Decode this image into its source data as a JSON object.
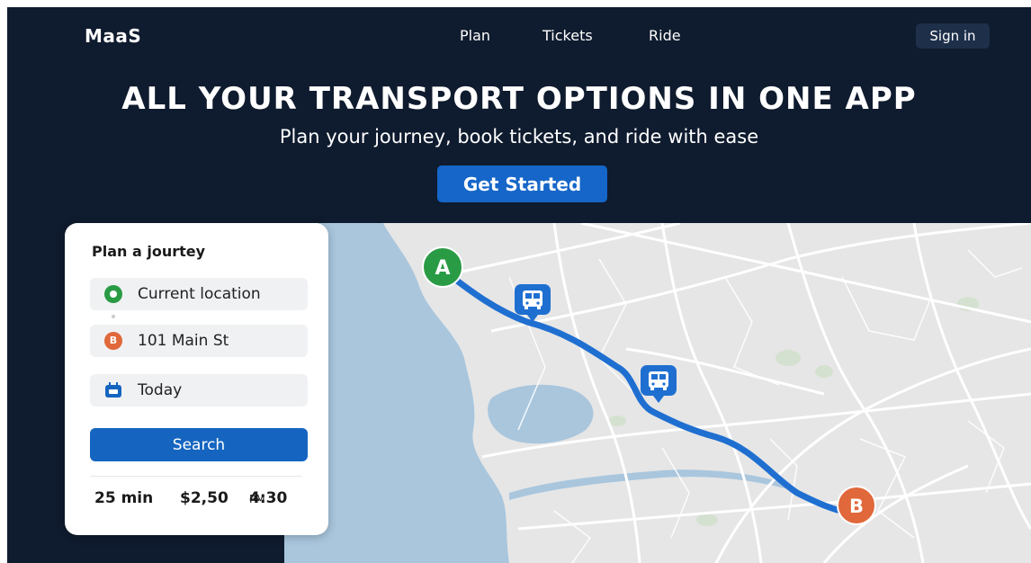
{
  "nav": {
    "brand": "MaaS",
    "items": [
      {
        "label": "Plan"
      },
      {
        "label": "Tickets"
      },
      {
        "label": "Ride"
      }
    ],
    "signin_label": "Sign in"
  },
  "hero": {
    "title": "ALL YOUR TRANSPORT OPTIONS IN ONE APP",
    "subtitle": "Plan your journey, book tickets, and ride with ease",
    "cta_label": "Get Started"
  },
  "planner": {
    "title": "Plan a jourtey",
    "origin": {
      "value": "Current location",
      "icon": "location-dot-icon"
    },
    "destination": {
      "value": "101 Main St",
      "marker": "B"
    },
    "date": {
      "value": "Today",
      "icon": "calendar-icon"
    },
    "search_label": "Search",
    "summary": {
      "duration": "25 min",
      "price": "$2,50",
      "time": "4:30",
      "time_suffix": "PM"
    }
  },
  "map": {
    "start_marker": "A",
    "end_marker": "B",
    "stop_icons": [
      "bus-icon",
      "bus-icon"
    ],
    "colors": {
      "route": "#1f6fd1",
      "water": "#a9c6dd",
      "land": "#e6e6e6",
      "start": "#2a9b45",
      "end": "#e0683a"
    }
  },
  "colors": {
    "header_bg": "#0f1b2e",
    "accent": "#1566c8",
    "signin_bg": "#1d2f49"
  }
}
